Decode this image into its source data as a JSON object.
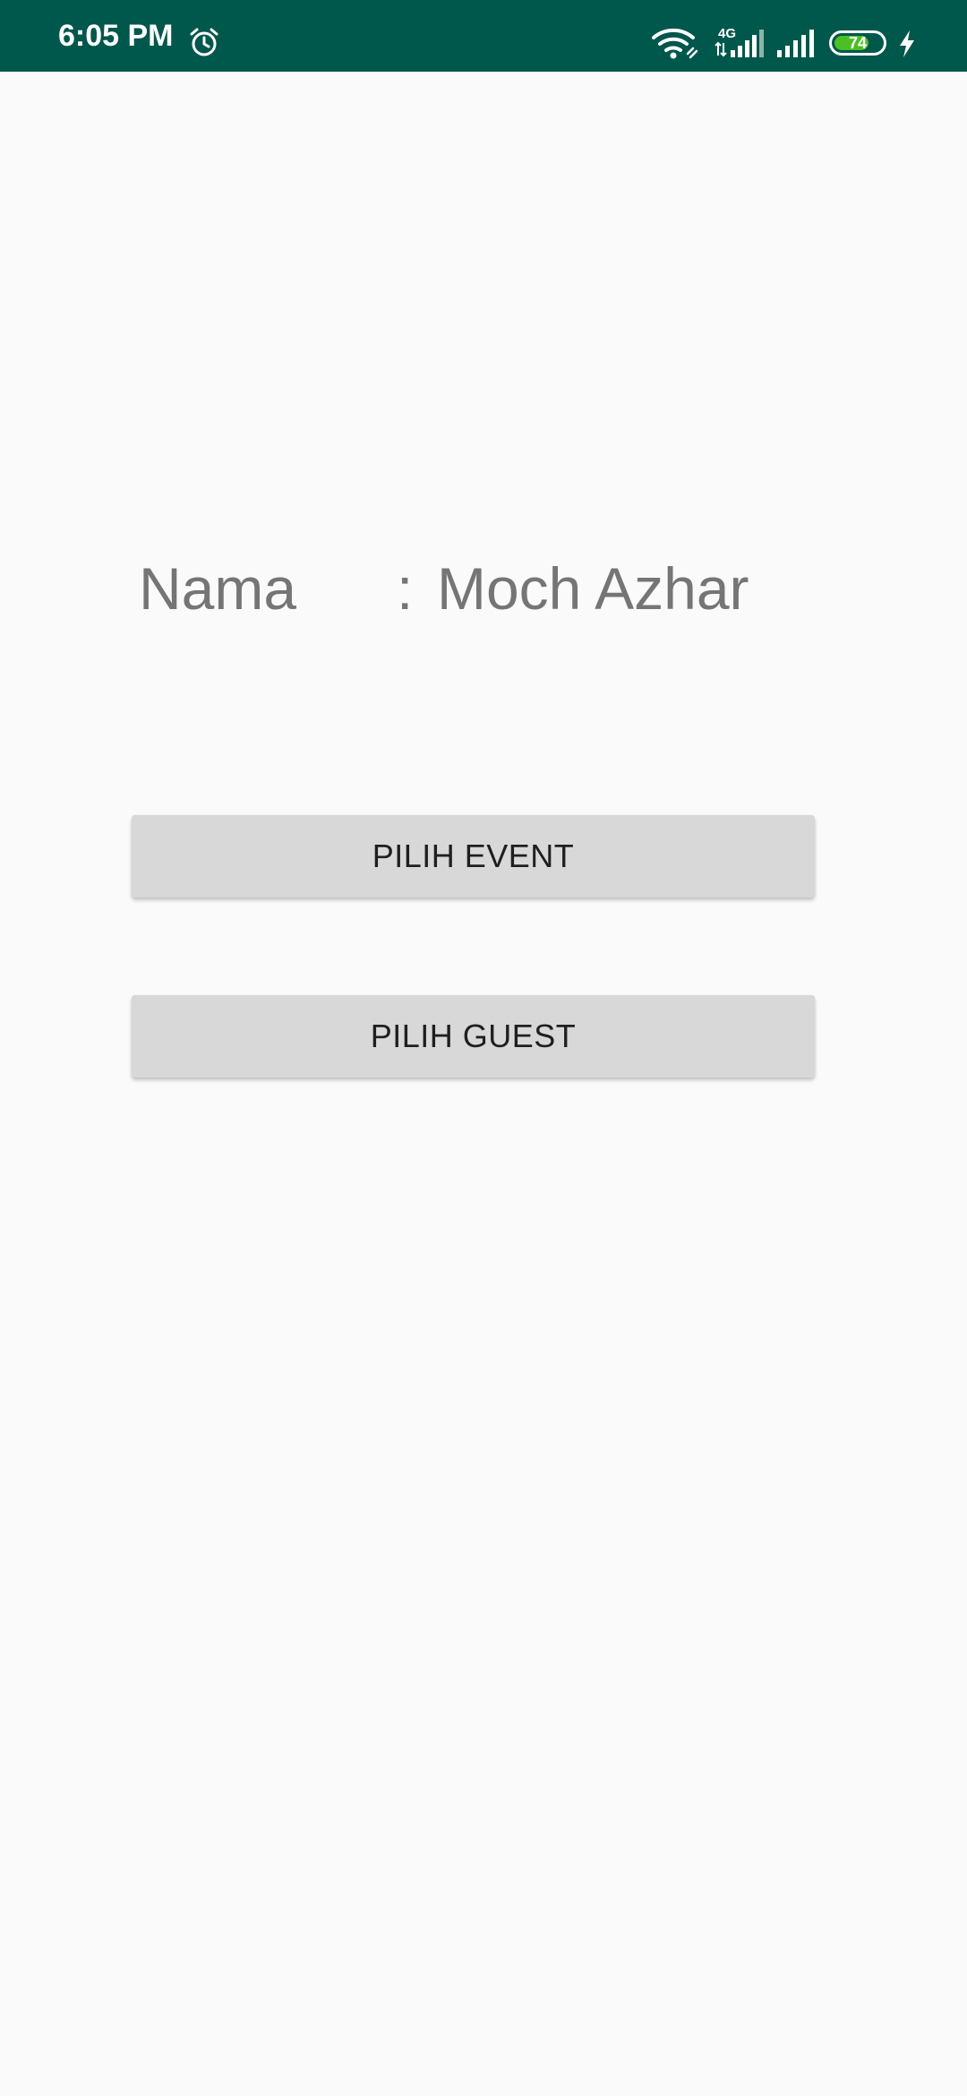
{
  "status_bar": {
    "time": "6:05 PM",
    "alarm_icon": "alarm-clock-icon",
    "wifi_icon": "wifi-icon",
    "network_type": "4G",
    "signal_icons": [
      "signal-strength-icon",
      "signal-strength-icon"
    ],
    "battery_level": "74",
    "charging_icon": "bolt-icon",
    "background_color": "#00574b",
    "battery_color": "#4cbf24"
  },
  "profile": {
    "name_label": "Nama",
    "separator": ":",
    "name_value": "Moch Azhar"
  },
  "actions": {
    "event_button": "PILIH EVENT",
    "guest_button": "PILIH GUEST"
  },
  "colors": {
    "page_background": "#fafafa",
    "button_background": "#d7d8d7",
    "label_text": "#757575"
  }
}
